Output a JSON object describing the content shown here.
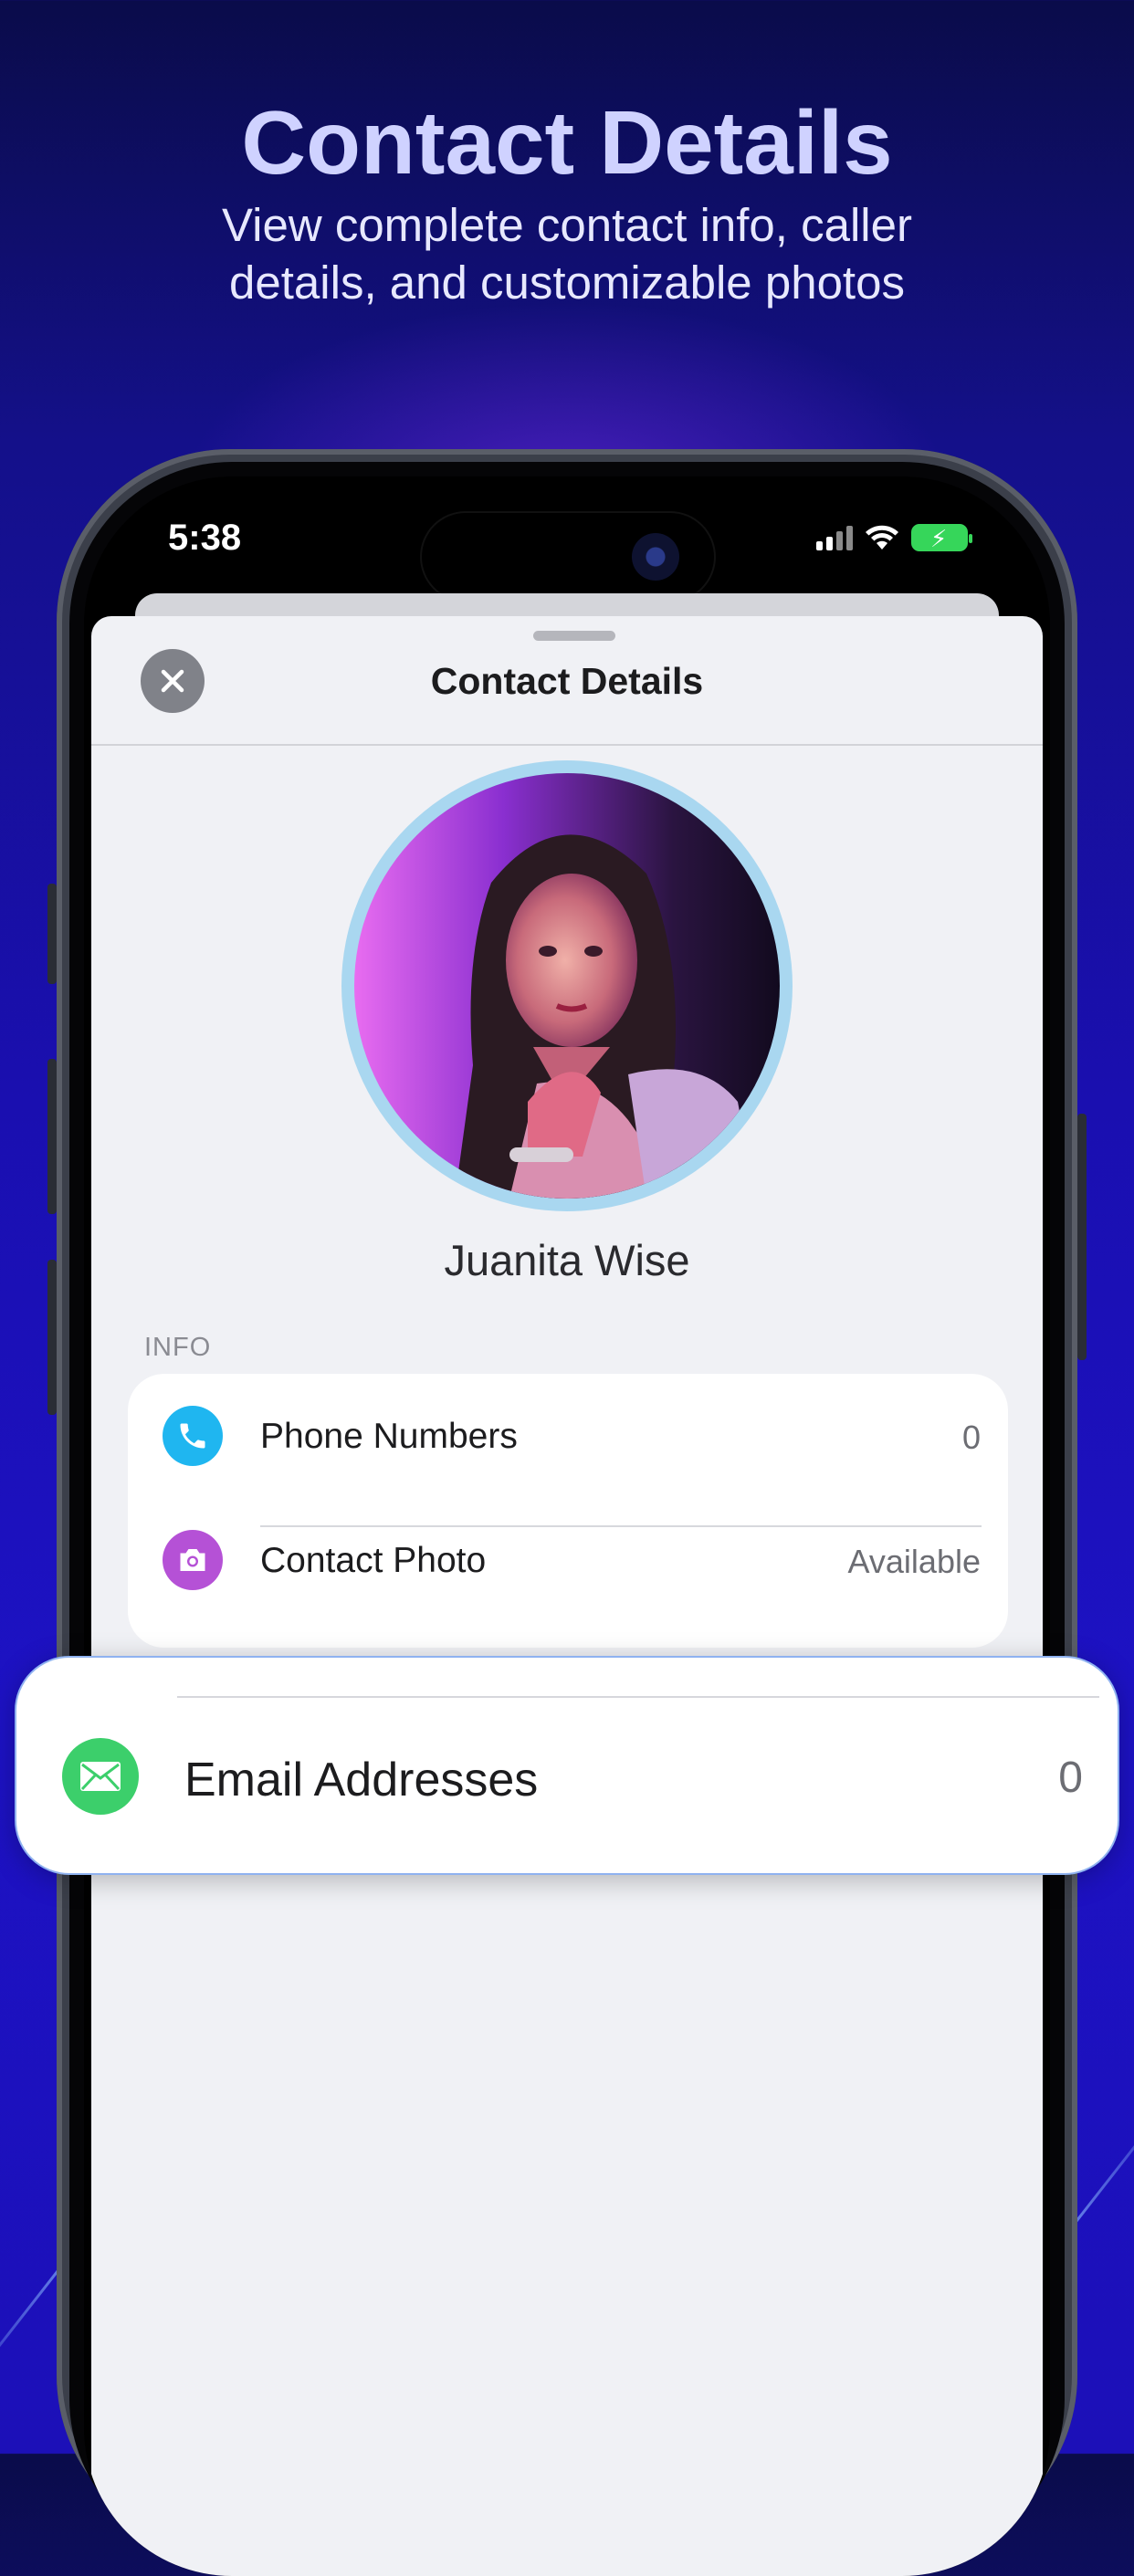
{
  "promo": {
    "headline": "Contact Details",
    "subline": "View complete contact info, caller details, and customizable photos"
  },
  "status_bar": {
    "time": "5:38",
    "icons": [
      "cellular-signal-icon",
      "wifi-icon",
      "battery-charging-icon"
    ]
  },
  "sheet": {
    "title": "Contact Details",
    "close_icon": "close-icon"
  },
  "contact": {
    "name": "Juanita Wise"
  },
  "info": {
    "section_label": "INFO",
    "rows": [
      {
        "label": "Phone Numbers",
        "value": "0",
        "icon": "phone-icon",
        "color": "#1fb6f0"
      },
      {
        "label": "Contact Photo",
        "value": "Available",
        "icon": "camera-icon",
        "color": "#b551d6"
      }
    ]
  },
  "highlight": {
    "label": "Email Addresses",
    "value": "0",
    "icon": "mail-icon",
    "color": "#3ccf6b"
  },
  "colors": {
    "accent_blue": "#1fb6f0",
    "accent_purple": "#b551d6",
    "accent_green": "#3ccf6b",
    "headline": "#cfd2ff"
  }
}
